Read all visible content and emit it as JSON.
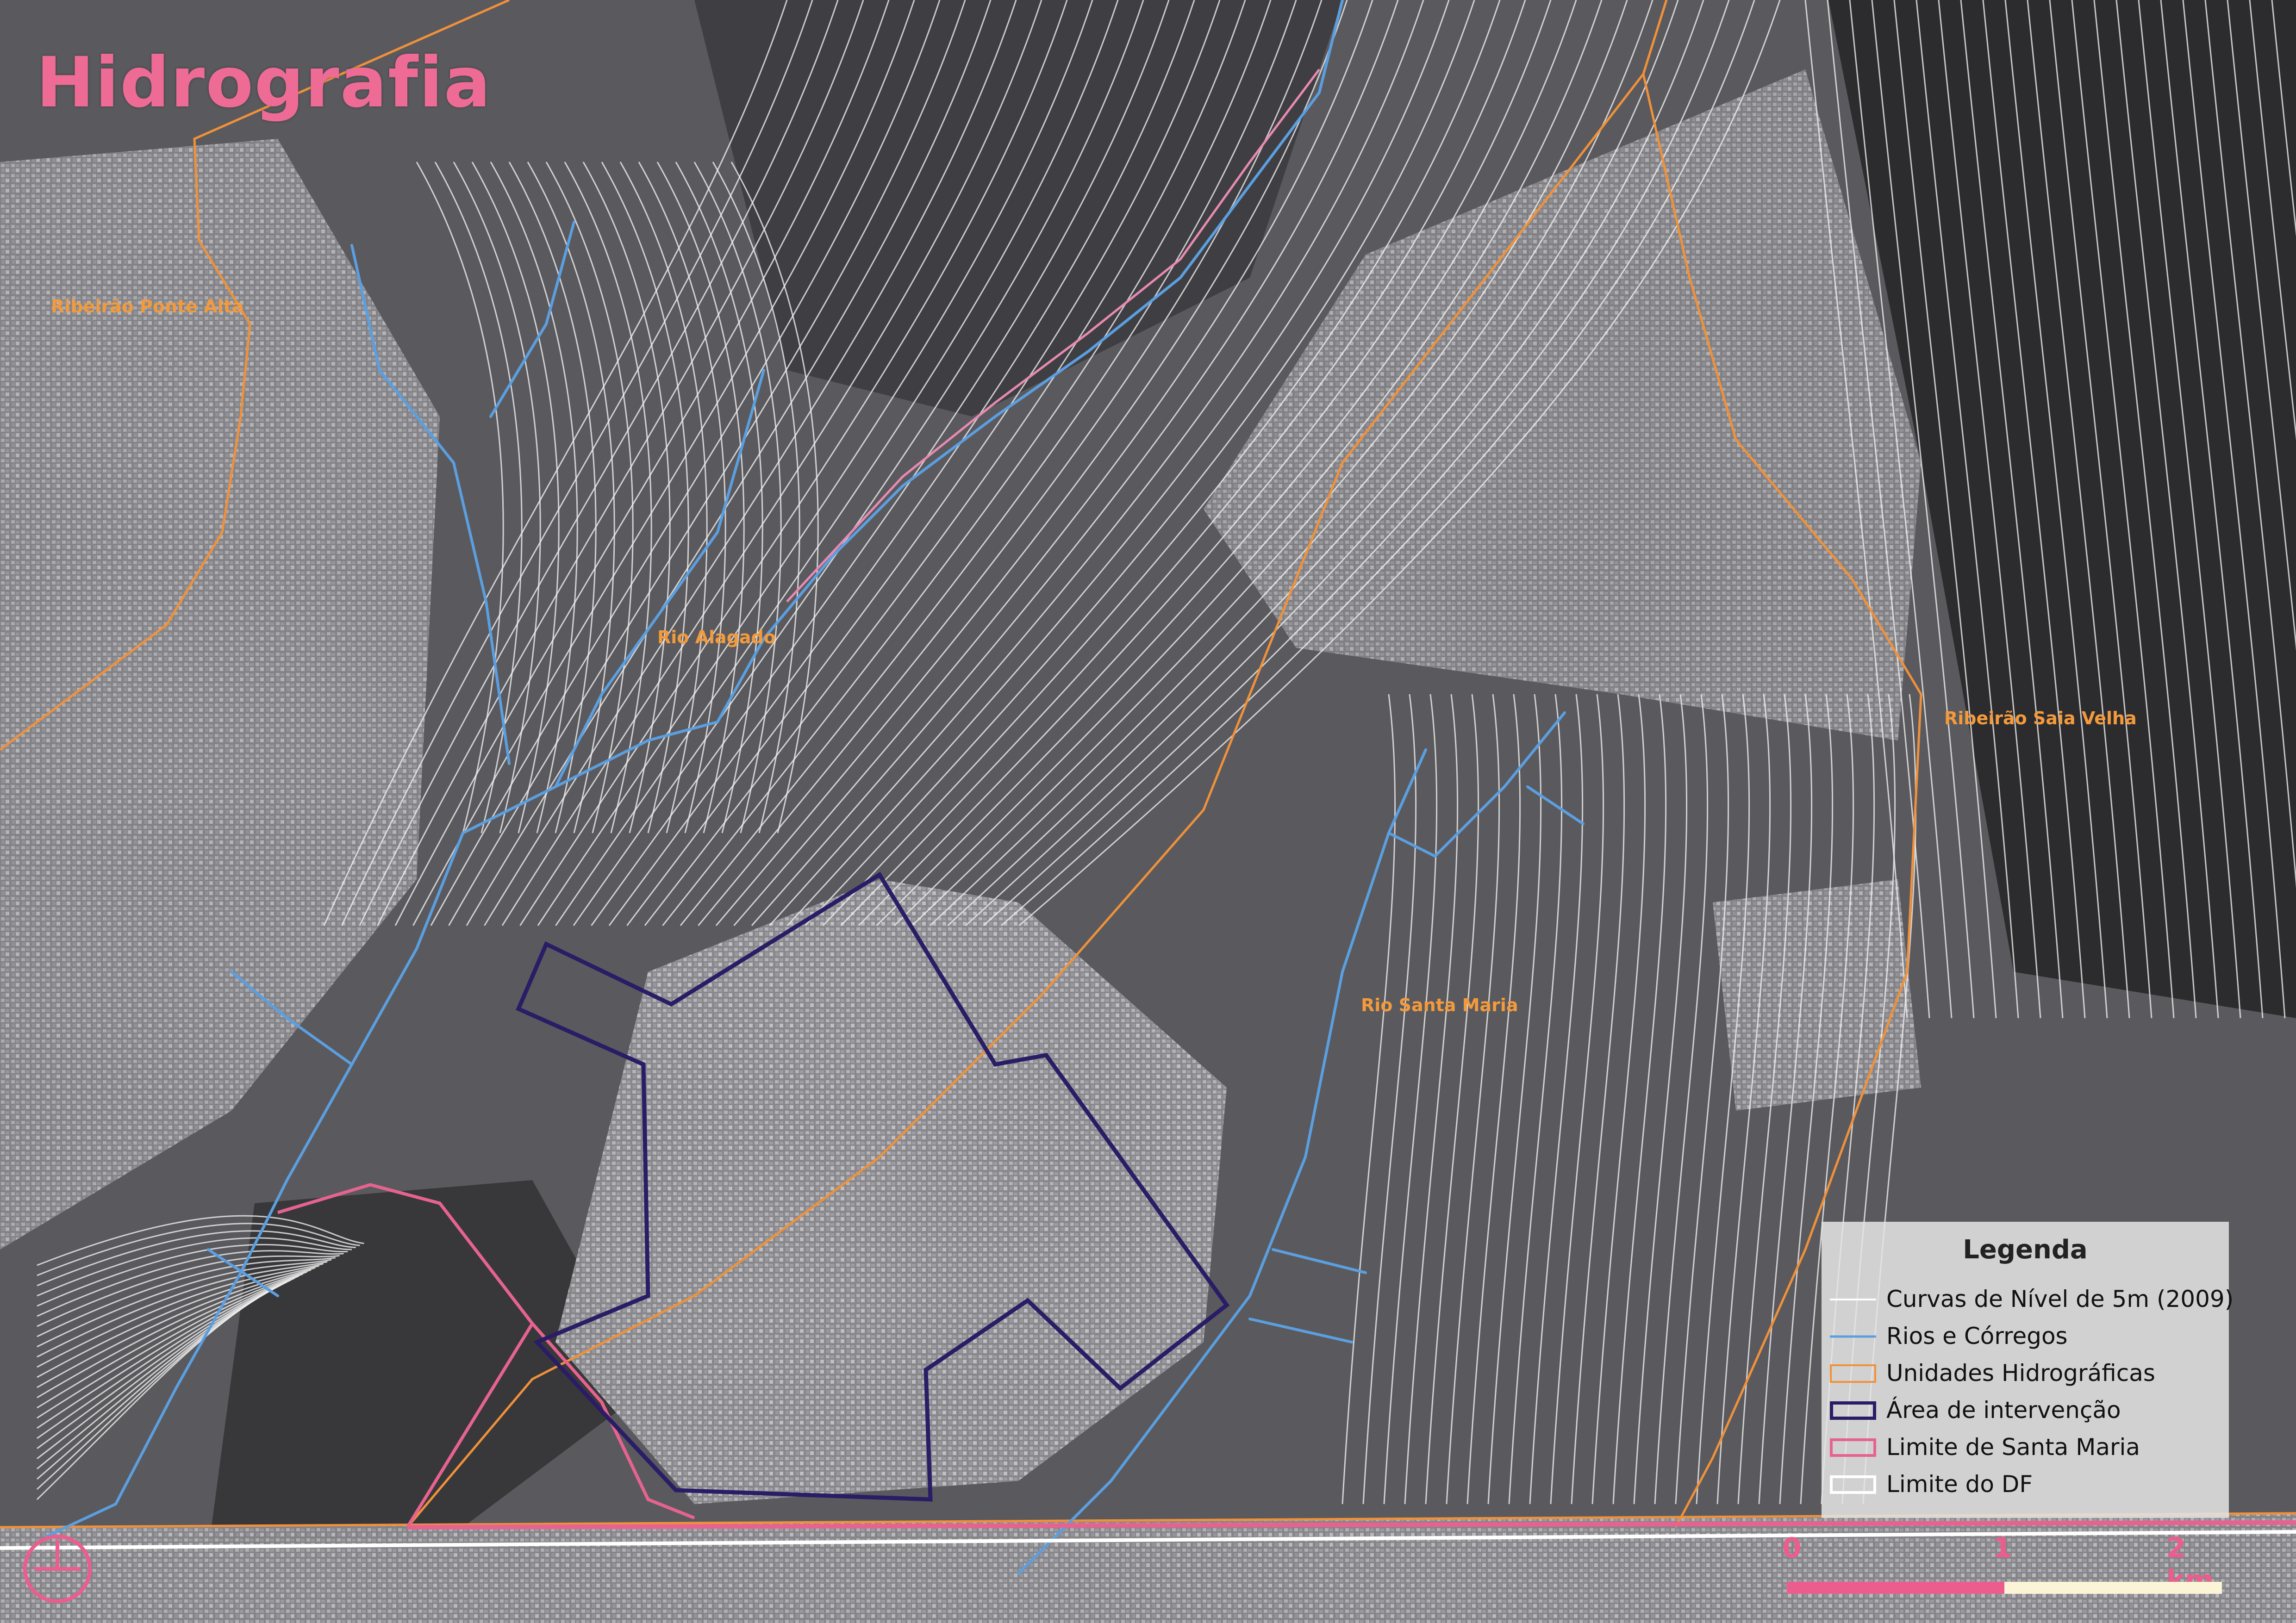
{
  "title": "Hidrografia",
  "colors": {
    "contour": "#eeeeee",
    "river": "#5b9fe0",
    "hydro_unit": "#f0913a",
    "intervention_area": "#2a1d66",
    "santa_maria_limit": "#e6638f",
    "df_limit": "#ffffff",
    "title": "#ee6b96",
    "river_label": "#f39a3c"
  },
  "map_labels": [
    {
      "text": "Ribeirão Ponte Alta",
      "kind": "hydro_unit"
    },
    {
      "text": "Rio Alagado",
      "kind": "hydro_unit"
    },
    {
      "text": "Ribeirão Saia Velha",
      "kind": "hydro_unit"
    },
    {
      "text": "Rio Santa Maria",
      "kind": "hydro_unit"
    }
  ],
  "legend": {
    "title": "Legenda",
    "items": [
      {
        "label": "Curvas de Nível de 5m (2009)",
        "symbol": "contour-line"
      },
      {
        "label": "Rios e Córregos",
        "symbol": "river-line"
      },
      {
        "label": "Unidades Hidrográficas",
        "symbol": "hydro-unit-box"
      },
      {
        "label": "Área de intervenção",
        "symbol": "intervention-box"
      },
      {
        "label": "Limite de Santa Maria",
        "symbol": "santa-maria-box"
      },
      {
        "label": "Limite do DF",
        "symbol": "df-box"
      }
    ]
  },
  "scale_bar": {
    "ticks": [
      "0",
      "1",
      "2 km"
    ]
  },
  "north_arrow": "north-arrow-icon"
}
